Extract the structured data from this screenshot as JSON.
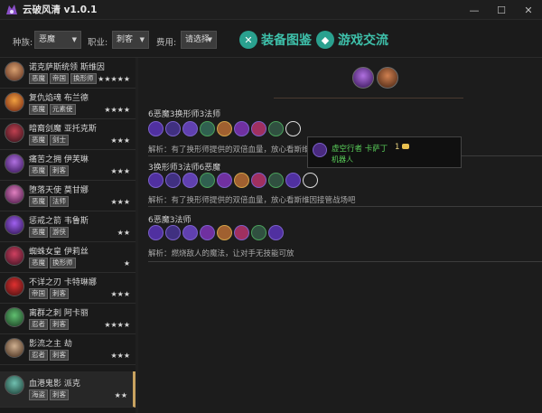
{
  "app": {
    "title": "云破风清 v1.0.1"
  },
  "window": {
    "minimize": "—",
    "maximize": "☐",
    "close": "✕"
  },
  "filters": [
    {
      "label": "种族:",
      "value": "恶魔"
    },
    {
      "label": "职业:",
      "value": "刺客"
    },
    {
      "label": "费用:",
      "value": "请选择"
    }
  ],
  "actions": {
    "equipment": "装备图鉴",
    "community": "游戏交流"
  },
  "heroes": [
    {
      "name": "诺克萨斯统领 斯维因",
      "tags": [
        "恶魔",
        "帝国",
        "换形师"
      ],
      "stars": "★★★★★"
    },
    {
      "name": "复仇焰魂 布兰德",
      "tags": [
        "恶魔",
        "元素使"
      ],
      "stars": "★★★★"
    },
    {
      "name": "暗裔剑魔 亚托克斯",
      "tags": [
        "恶魔",
        "剑士"
      ],
      "stars": "★★★"
    },
    {
      "name": "痛苦之拥 伊芙琳",
      "tags": [
        "恶魔",
        "刺客"
      ],
      "stars": "★★★"
    },
    {
      "name": "堕落天使 莫甘娜",
      "tags": [
        "恶魔",
        "法师"
      ],
      "stars": "★★★"
    },
    {
      "name": "惩戒之箭 韦鲁斯",
      "tags": [
        "恶魔",
        "游侠"
      ],
      "stars": "★★"
    },
    {
      "name": "蜘蛛女皇 伊莉丝",
      "tags": [
        "恶魔",
        "换形师"
      ],
      "stars": "★"
    },
    {
      "name": "不详之刃 卡特琳娜",
      "tags": [
        "帝国",
        "刺客"
      ],
      "stars": "★★★"
    },
    {
      "name": "离群之刺 阿卡丽",
      "tags": [
        "忍者",
        "刺客"
      ],
      "stars": "★★★★"
    },
    {
      "name": "影流之主 劫",
      "tags": [
        "忍者",
        "刺客"
      ],
      "stars": "★★★"
    },
    {
      "name": "血港鬼影 派克",
      "tags": [
        "海盗",
        "刺客"
      ],
      "stars": "★★"
    }
  ],
  "compositions": [
    {
      "title": "6恶魔3换形师3法师",
      "desc": "解析：有了换形师提供的双倍血量，放心看斯维因"
    },
    {
      "title": "3换形师3法师6恶魔",
      "desc": "解析：有了换形师提供的双倍血量，放心看斯维因接管战场吧"
    },
    {
      "title": "6恶魔3法师",
      "desc": "解析：燃烧敌人的魔法，让对手无技能可放"
    }
  ],
  "tooltip": {
    "name": "虚空行者 卡萨丁",
    "cost": "1",
    "trait": "机器人"
  },
  "icons": {
    "app": "pirate-logo-icon",
    "equipment": "equipment-book-icon",
    "community": "chat-icon",
    "coin": "coin-icon"
  },
  "colors": {
    "accent": "#2aa18f",
    "gold": "#c9a360",
    "tooltip_name": "#5ad05a"
  }
}
